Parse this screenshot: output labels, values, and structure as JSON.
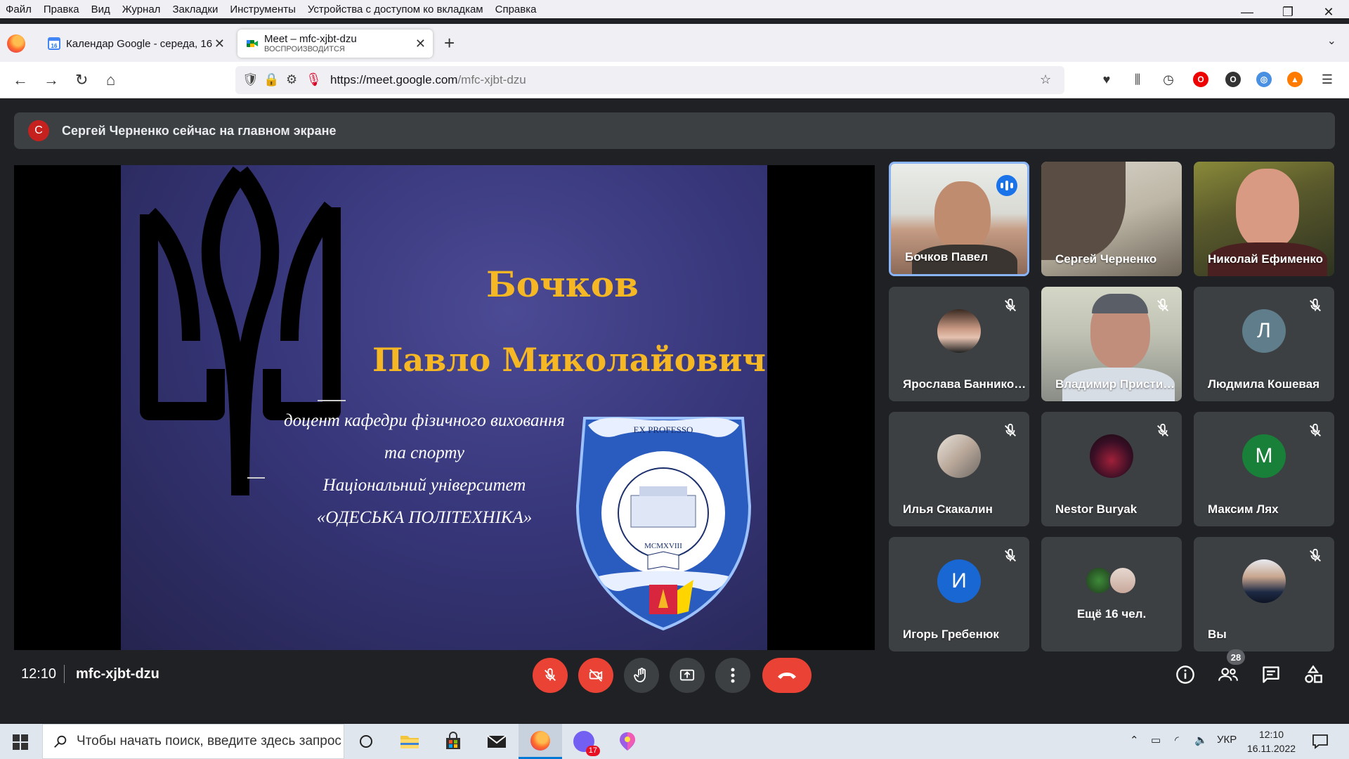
{
  "menubar": {
    "items": [
      "Файл",
      "Правка",
      "Вид",
      "Журнал",
      "Закладки",
      "Инструменты",
      "Устройства с доступом ко вкладкам",
      "Справка"
    ]
  },
  "window_controls": {
    "minimize": "—",
    "restore": "❐",
    "close": "✕"
  },
  "tabs": [
    {
      "title": "Календар Google - середа, 16",
      "close": "✕"
    },
    {
      "title": "Meet – mfc-xjbt-dzu",
      "subtitle": "ВОСПРОИЗВОДИТСЯ",
      "close": "✕"
    }
  ],
  "toolbar": {
    "url_host": "https://meet.google.com",
    "url_path": "/mfc-xjbt-dzu"
  },
  "banner": {
    "avatar_letter": "С",
    "text": "Сергей Черненко сейчас на главном экране",
    "avatar_color": "#c5221f"
  },
  "slide": {
    "surname": "Бочков",
    "fullname": "Павло Миколайович",
    "lines": [
      "доцент кафедри фізичного виховання",
      "та спорту",
      "Національний університет",
      "«ОДЕСЬКА ПОЛІТЕХНІКА»"
    ],
    "crest_motto": "EX PROFESSO",
    "crest_year": "MCMXVIII",
    "accent": "#f5b723"
  },
  "participants": [
    {
      "name": "Бочков Павел",
      "speaking": true
    },
    {
      "name": "Сергей Черненко"
    },
    {
      "name": "Николай Ефименко"
    },
    {
      "name": "Ярослава Банникова",
      "muted": true
    },
    {
      "name": "Владимир Пристинский",
      "muted": true
    },
    {
      "name": "Людмила Кошевая",
      "muted": true,
      "letter": "Л",
      "color": "#5f7d8b"
    },
    {
      "name": "Илья Скакалин",
      "muted": true
    },
    {
      "name": "Nestor Buryak",
      "muted": true
    },
    {
      "name": "Максим Лях",
      "muted": true,
      "letter": "М",
      "color": "#188038"
    },
    {
      "name": "Игорь Гребенюк",
      "muted": true,
      "letter": "И",
      "color": "#1967d2"
    },
    {
      "name": "Ещё 16 чел."
    },
    {
      "name": "Вы",
      "muted": true
    }
  ],
  "bottombar": {
    "time": "12:10",
    "meeting_code": "mfc-xjbt-dzu",
    "people_count": "28"
  },
  "taskbar": {
    "search_placeholder": "Чтобы начать поиск, введите здесь запрос",
    "viber_badge": "17",
    "lang": "УКР",
    "clock_time": "12:10",
    "clock_date": "16.11.2022"
  }
}
